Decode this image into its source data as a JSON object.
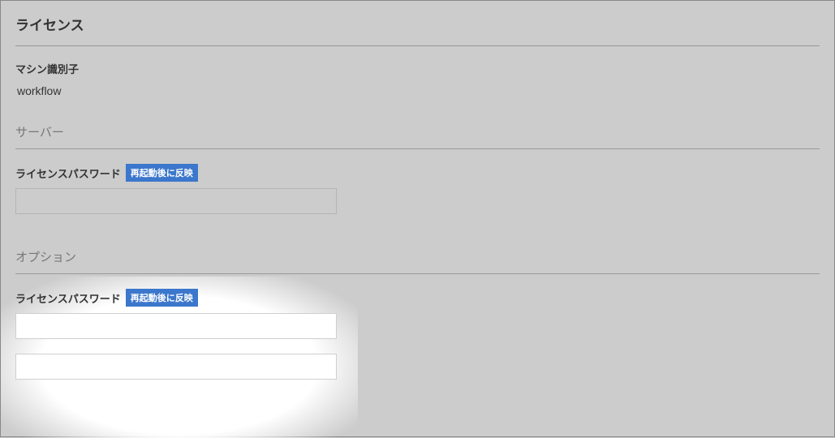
{
  "page": {
    "title": "ライセンス"
  },
  "machine": {
    "label": "マシン識別子",
    "value": "workflow"
  },
  "server": {
    "heading": "サーバー",
    "password_label": "ライセンスパスワード",
    "badge": "再起動後に反映",
    "password_value": ""
  },
  "options": {
    "heading": "オプション",
    "password_label": "ライセンスパスワード",
    "badge": "再起動後に反映",
    "input1_value": "",
    "input2_value": ""
  }
}
